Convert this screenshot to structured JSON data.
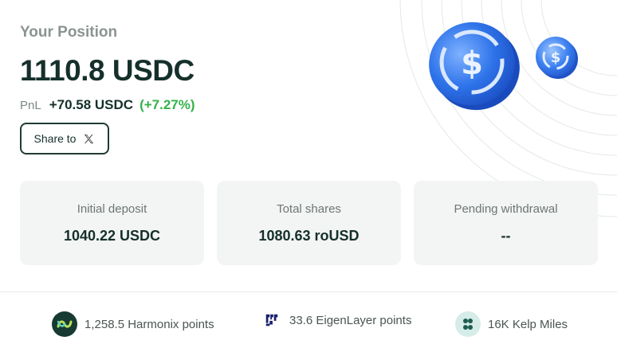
{
  "position": {
    "title": "Your Position",
    "amount": "1110.8 USDC",
    "pnl_label": "PnL",
    "pnl_value": "+70.58 USDC",
    "pnl_percent": "(+7.27%)"
  },
  "share": {
    "label": "Share to",
    "icon": "x-logo-icon"
  },
  "stats": [
    {
      "label": "Initial deposit",
      "value": "1040.22 USDC"
    },
    {
      "label": "Total shares",
      "value": "1080.63 roUSD"
    },
    {
      "label": "Pending withdrawal",
      "value": "--"
    }
  ],
  "points": [
    {
      "text": "1,258.5 Harmonix points",
      "icon": "harmonix-icon"
    },
    {
      "text": "33.6 EigenLayer points",
      "icon": "eigenlayer-icon"
    },
    {
      "text": "16K Kelp Miles",
      "icon": "kelp-icon"
    }
  ],
  "colors": {
    "text_dark": "#15302b",
    "pnl_green": "#34b24a",
    "card_bg": "#f3f4f4",
    "coin_blue": "#2b6fe6"
  }
}
